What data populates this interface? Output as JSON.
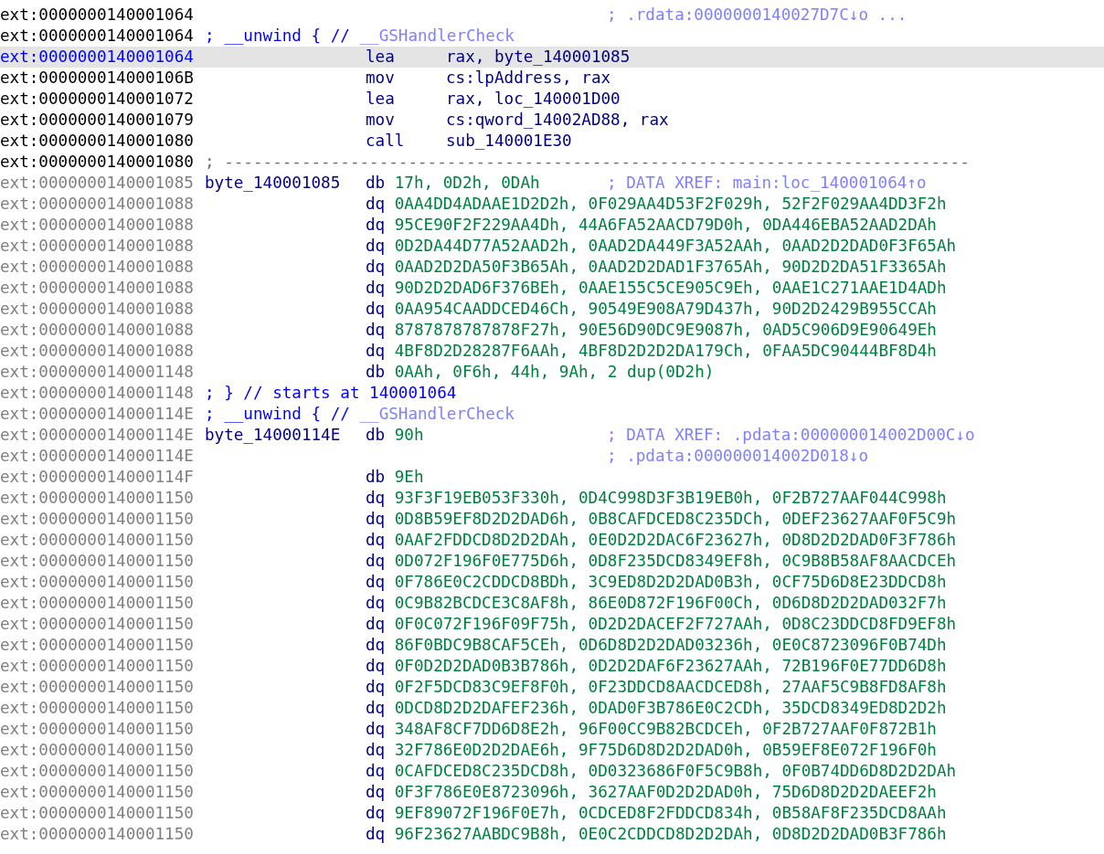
{
  "listing": {
    "rows": [
      {
        "address": "ext:0000000140001064",
        "kind": "code",
        "selected": false,
        "xref": "; .rdata:0000000140027D7C↓o ..."
      },
      {
        "address": "ext:0000000140001064",
        "kind": "code",
        "selected": false,
        "comment": "; __unwind { //",
        "xref": "__GSHandlerCheck"
      },
      {
        "address": "ext:0000000140001064",
        "kind": "code",
        "selected": true,
        "mnemonic": "lea",
        "operands": "rax, byte_140001085"
      },
      {
        "address": "ext:000000014000106B",
        "kind": "code",
        "selected": false,
        "mnemonic": "mov",
        "operands": "cs:lpAddress, rax"
      },
      {
        "address": "ext:0000000140001072",
        "kind": "code",
        "selected": false,
        "mnemonic": "lea",
        "operands": "rax, loc_140001D00"
      },
      {
        "address": "ext:0000000140001079",
        "kind": "code",
        "selected": false,
        "mnemonic": "mov",
        "operands": "cs:qword_14002AD88, rax"
      },
      {
        "address": "ext:0000000140001080",
        "kind": "code",
        "selected": false,
        "mnemonic": "call",
        "operands": "sub_140001E30"
      },
      {
        "address": "ext:0000000140001080",
        "kind": "code",
        "selected": false,
        "separator": "; -----------------------------------------------------------------------------"
      },
      {
        "address": "ext:0000000140001085",
        "kind": "data",
        "selected": false,
        "label": "byte_140001085",
        "mnemonic": "db",
        "operands": "17h, 0D2h, 0DAh",
        "xref": "; DATA XREF: main:loc_140001064↑o"
      },
      {
        "address": "ext:0000000140001088",
        "kind": "data",
        "selected": false,
        "mnemonic": "dq",
        "operands": "0AA4DD4ADAAE1D2D2h, 0F029AA4D53F2F029h, 52F2F029AA4DD3F2h"
      },
      {
        "address": "ext:0000000140001088",
        "kind": "data",
        "selected": false,
        "mnemonic": "dq",
        "operands": "95CE90F2F229AA4Dh, 44A6FA52AACD79D0h, 0DA446EBA52AAD2DAh"
      },
      {
        "address": "ext:0000000140001088",
        "kind": "data",
        "selected": false,
        "mnemonic": "dq",
        "operands": "0D2DA44D77A52AAD2h, 0AAD2DA449F3A52AAh, 0AAD2D2DAD0F3F65Ah"
      },
      {
        "address": "ext:0000000140001088",
        "kind": "data",
        "selected": false,
        "mnemonic": "dq",
        "operands": "0AAD2D2DA50F3B65Ah, 0AAD2D2DAD1F3765Ah, 90D2D2DA51F3365Ah"
      },
      {
        "address": "ext:0000000140001088",
        "kind": "data",
        "selected": false,
        "mnemonic": "dq",
        "operands": "90D2D2DAD6F376BEh, 0AAE155C5CE905C9Eh, 0AAE1C271AAE1D4ADh"
      },
      {
        "address": "ext:0000000140001088",
        "kind": "data",
        "selected": false,
        "mnemonic": "dq",
        "operands": "0AA954CAADDCED46Ch, 90549E908A79D437h, 90D2D2429B955CCAh"
      },
      {
        "address": "ext:0000000140001088",
        "kind": "data",
        "selected": false,
        "mnemonic": "dq",
        "operands": "8787878787878F27h, 90E56D90DC9E9087h, 0AD5C906D9E90649Eh"
      },
      {
        "address": "ext:0000000140001088",
        "kind": "data",
        "selected": false,
        "mnemonic": "dq",
        "operands": "4BF8D2D28287F6AAh, 4BF8D2D2D2DA179Ch, 0FAA5DC90444BF8D4h"
      },
      {
        "address": "ext:0000000140001148",
        "kind": "data",
        "selected": false,
        "mnemonic": "db",
        "operands": "0AAh, 0F6h, 44h, 9Ah, 2 dup(0D2h)"
      },
      {
        "address": "ext:0000000140001148",
        "kind": "data",
        "selected": false,
        "comment": "; } // starts at 140001064"
      },
      {
        "address": "ext:000000014000114E",
        "kind": "data",
        "selected": false,
        "comment": "; __unwind { //",
        "xref": "__GSHandlerCheck"
      },
      {
        "address": "ext:000000014000114E",
        "kind": "data",
        "selected": false,
        "label": "byte_14000114E",
        "mnemonic": "db",
        "operands": "90h",
        "xref": "; DATA XREF: .pdata:000000014002D00C↓o"
      },
      {
        "address": "ext:000000014000114E",
        "kind": "data",
        "selected": false,
        "xref": "; .pdata:000000014002D018↓o"
      },
      {
        "address": "ext:000000014000114F",
        "kind": "data",
        "selected": false,
        "mnemonic": "db",
        "operands": "9Eh"
      },
      {
        "address": "ext:0000000140001150",
        "kind": "data",
        "selected": false,
        "mnemonic": "dq",
        "operands": "93F3F19EB053F330h, 0D4C998D3F3B19EB0h, 0F2B727AAF044C998h"
      },
      {
        "address": "ext:0000000140001150",
        "kind": "data",
        "selected": false,
        "mnemonic": "dq",
        "operands": "0D8B59EF8D2D2DAD6h, 0B8CAFDCED8C235DCh, 0DEF23627AAF0F5C9h"
      },
      {
        "address": "ext:0000000140001150",
        "kind": "data",
        "selected": false,
        "mnemonic": "dq",
        "operands": "0AAF2FDDCD8D2D2DAh, 0E0D2D2DAC6F23627h, 0D8D2D2DAD0F3F786h"
      },
      {
        "address": "ext:0000000140001150",
        "kind": "data",
        "selected": false,
        "mnemonic": "dq",
        "operands": "0D072F196F0E775D6h, 0D8F235DCD8349EF8h, 0C9B8B58AF8AACDCEh"
      },
      {
        "address": "ext:0000000140001150",
        "kind": "data",
        "selected": false,
        "mnemonic": "dq",
        "operands": "0F786E0C2CDDCD8BDh, 3C9ED8D2D2DAD0B3h, 0CF75D6D8E23DDCD8h"
      },
      {
        "address": "ext:0000000140001150",
        "kind": "data",
        "selected": false,
        "mnemonic": "dq",
        "operands": "0C9B82BCDCE3C8AF8h, 86E0D872F196F00Ch, 0D6D8D2D2DAD032F7h"
      },
      {
        "address": "ext:0000000140001150",
        "kind": "data",
        "selected": false,
        "mnemonic": "dq",
        "operands": "0F0C072F196F09F75h, 0D2D2DACEF2F727AAh, 0D8C23DDCD8FD9EF8h"
      },
      {
        "address": "ext:0000000140001150",
        "kind": "data",
        "selected": false,
        "mnemonic": "dq",
        "operands": "86F0BDC9B8CAF5CEh, 0D6D8D2D2DAD03236h, 0E0C8723096F0B74Dh"
      },
      {
        "address": "ext:0000000140001150",
        "kind": "data",
        "selected": false,
        "mnemonic": "dq",
        "operands": "0F0D2D2DAD0B3B786h, 0D2D2DAF6F23627AAh, 72B196F0E77DD6D8h"
      },
      {
        "address": "ext:0000000140001150",
        "kind": "data",
        "selected": false,
        "mnemonic": "dq",
        "operands": "0F2F5DCD83C9EF8F0h, 0F23DDCD8AACDCED8h, 27AAF5C9B8FD8AF8h"
      },
      {
        "address": "ext:0000000140001150",
        "kind": "data",
        "selected": false,
        "mnemonic": "dq",
        "operands": "0DCD8D2D2DAFEF236h, 0DAD0F3B786E0C2CDh, 35DCD8349ED8D2D2h"
      },
      {
        "address": "ext:0000000140001150",
        "kind": "data",
        "selected": false,
        "mnemonic": "dq",
        "operands": "348AF8CF7DD6D8E2h, 96F00CC9B82BCDCEh, 0F2B727AAF0F872B1h"
      },
      {
        "address": "ext:0000000140001150",
        "kind": "data",
        "selected": false,
        "mnemonic": "dq",
        "operands": "32F786E0D2D2DAE6h, 9F75D6D8D2D2DAD0h, 0B59EF8E072F196F0h"
      },
      {
        "address": "ext:0000000140001150",
        "kind": "data",
        "selected": false,
        "mnemonic": "dq",
        "operands": "0CAFDCED8C235DCD8h, 0D0323686F0F5C9B8h, 0F0B74DD6D8D2D2DAh"
      },
      {
        "address": "ext:0000000140001150",
        "kind": "data",
        "selected": false,
        "mnemonic": "dq",
        "operands": "0F3F786E0E8723096h, 3627AAF0D2D2DAD0h, 75D6D8D2D2DAEEF2h"
      },
      {
        "address": "ext:0000000140001150",
        "kind": "data",
        "selected": false,
        "mnemonic": "dq",
        "operands": "9EF89072F196F0E7h, 0CDCED8F2FDDCD834h, 0B58AF8F235DCD8AAh"
      },
      {
        "address": "ext:0000000140001150",
        "kind": "data",
        "selected": false,
        "mnemonic": "dq",
        "operands": "96F23627AABDC9B8h, 0E0C2CDDCD8D2D2DAh, 0D8D2D2DAD0B3F786h"
      }
    ]
  }
}
